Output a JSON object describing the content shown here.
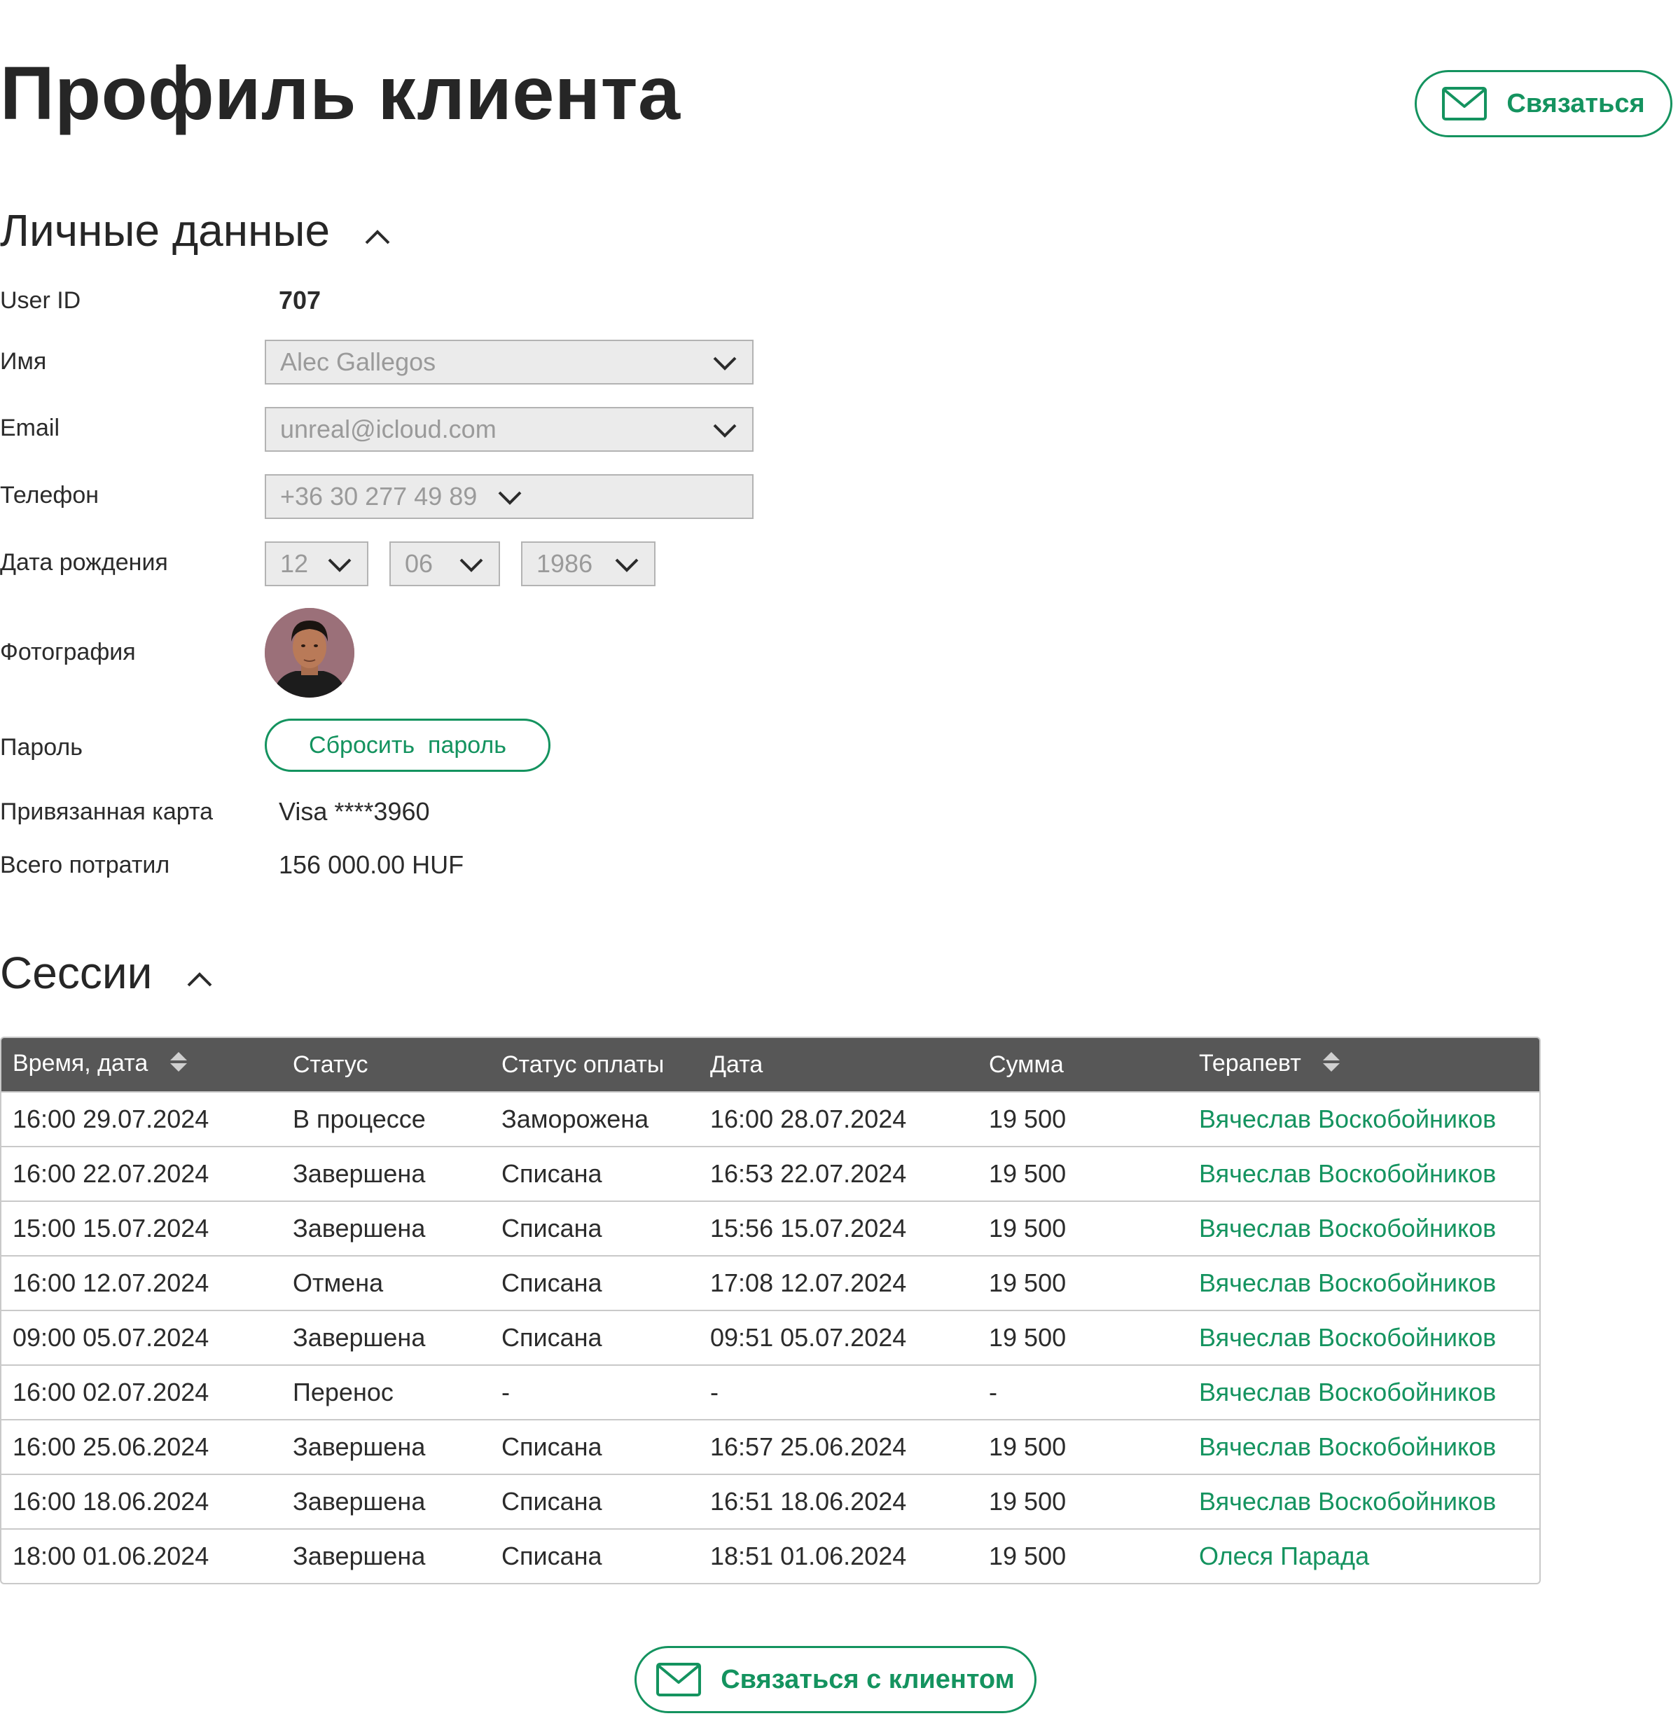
{
  "page": {
    "title": "Профиль клиента"
  },
  "header": {
    "contact_label": "Связаться"
  },
  "personal": {
    "section_title": "Личные данные",
    "user_id_label": "User ID",
    "user_id": "707",
    "name_label": "Имя",
    "name_value": "Alec Gallegos",
    "email_label": "Email",
    "email_value": "unreal@icloud.com",
    "phone_label": "Телефон",
    "phone_value": "+36 30 277 49 89",
    "birth_label": "Дата рождения",
    "birth_day": "12",
    "birth_month": "06",
    "birth_year": "1986",
    "photo_label": "Фотография",
    "password_label": "Пароль",
    "reset_password_label": "Сбросить  пароль",
    "card_label": "Привязанная карта",
    "card_value": "Visa ****3960",
    "spent_label": "Всего потратил",
    "spent_value": "156 000.00 HUF"
  },
  "sessions": {
    "section_title": "Сессии",
    "columns": [
      "Время, дата",
      "Статус",
      "Статус оплаты",
      "Дата",
      "Сумма",
      "Терапевт"
    ],
    "rows": [
      [
        "16:00  29.07.2024",
        "В процессе",
        "Заморожена",
        "16:00 28.07.2024",
        "19 500",
        "Вячеслав Воскобойников"
      ],
      [
        "16:00  22.07.2024",
        "Завершена",
        "Списана",
        "16:53 22.07.2024",
        "19 500",
        "Вячеслав Воскобойников"
      ],
      [
        "15:00  15.07.2024",
        "Завершена",
        "Списана",
        "15:56 15.07.2024",
        "19 500",
        "Вячеслав Воскобойников"
      ],
      [
        "16:00  12.07.2024",
        "Отмена",
        "Списана",
        "17:08 12.07.2024",
        "19 500",
        "Вячеслав Воскобойников"
      ],
      [
        "09:00  05.07.2024",
        "Завершена",
        "Списана",
        "09:51 05.07.2024",
        "19 500",
        "Вячеслав Воскобойников"
      ],
      [
        "16:00  02.07.2024",
        "Перенос",
        "-",
        "-",
        "-",
        "Вячеслав Воскобойников"
      ],
      [
        "16:00  25.06.2024",
        "Завершена",
        "Списана",
        "16:57 25.06.2024",
        "19 500",
        "Вячеслав Воскобойников"
      ],
      [
        "16:00  18.06.2024",
        "Завершена",
        "Списана",
        "16:51 18.06.2024",
        "19 500",
        "Вячеслав Воскобойников"
      ],
      [
        "18:00  01.06.2024",
        "Завершена",
        "Списана",
        "18:51 01.06.2024",
        "19 500",
        "Олеся Парада"
      ]
    ]
  },
  "footer": {
    "contact_client_label": "Связаться с клиентом"
  },
  "colors": {
    "accent": "#14935f",
    "header_bg": "#575757",
    "input_bg": "#ebebeb"
  },
  "icons": {
    "mail": "mail-icon",
    "chevron_up": "chevron-up-icon",
    "chevron_down": "chevron-down-icon",
    "sort": "sort-icon"
  }
}
